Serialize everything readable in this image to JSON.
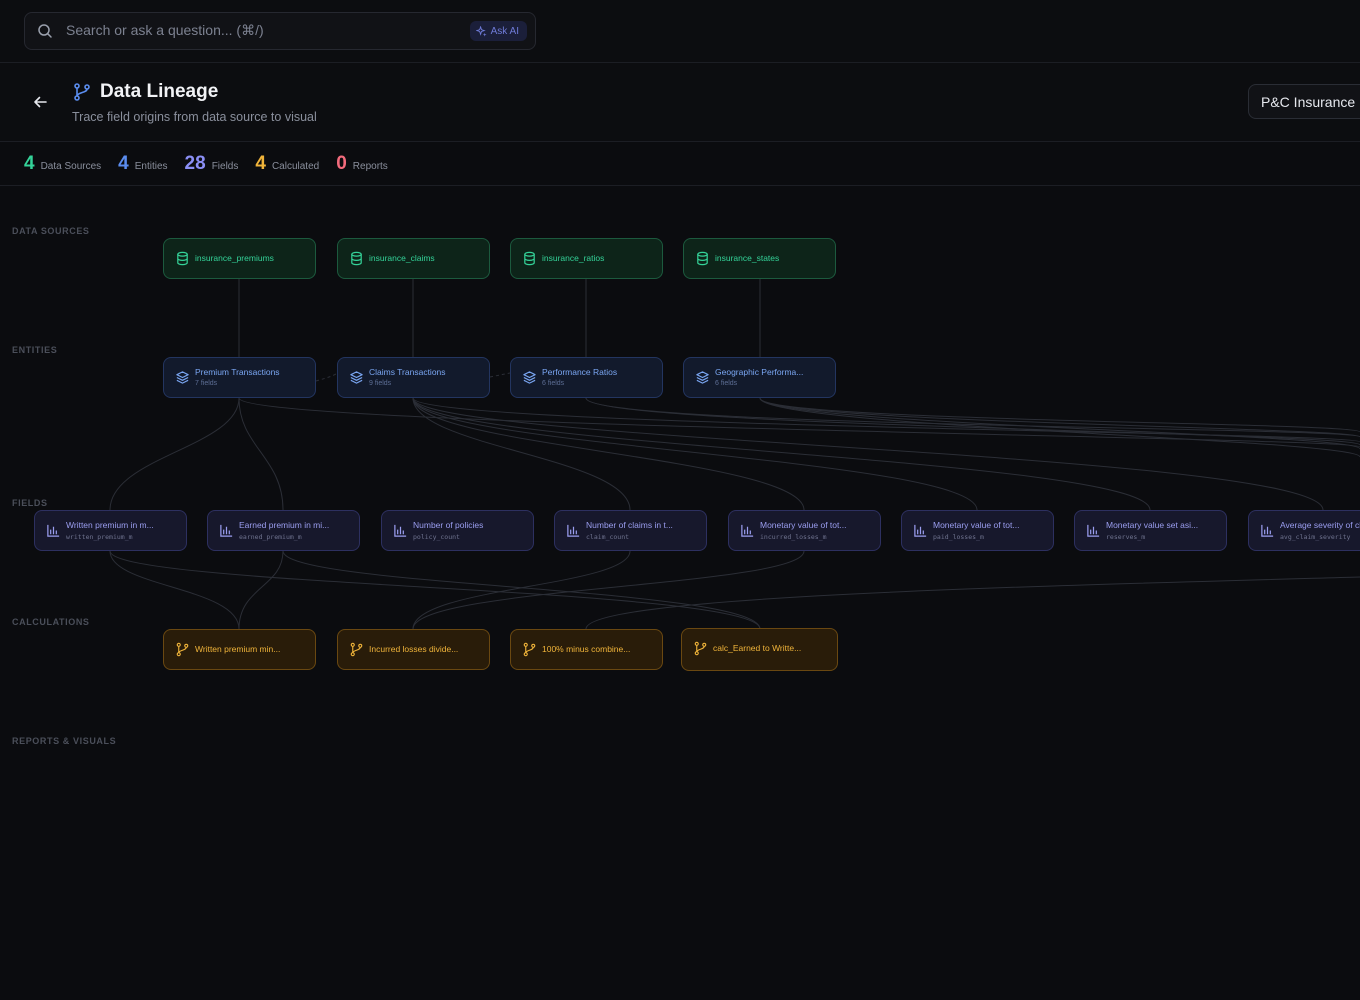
{
  "search": {
    "placeholder": "Search or ask a question... (⌘/)",
    "ask_ai_label": "Ask AI"
  },
  "header": {
    "title": "Data Lineage",
    "subtitle": "Trace field origins from data source to visual",
    "dataset_label": "P&C Insurance D"
  },
  "stats": [
    {
      "value": "4",
      "label": "Data Sources",
      "color": "#34d399"
    },
    {
      "value": "4",
      "label": "Entities",
      "color": "#5b8def"
    },
    {
      "value": "28",
      "label": "Fields",
      "color": "#8b8ff5"
    },
    {
      "value": "4",
      "label": "Calculated",
      "color": "#f0b43a"
    },
    {
      "value": "0",
      "label": "Reports",
      "color": "#f26b7c"
    }
  ],
  "lanes": {
    "data_sources": "DATA SOURCES",
    "entities": "ENTITIES",
    "fields": "FIELDS",
    "calculations": "CALCULATIONS",
    "reports": "REPORTS & VISUALS"
  },
  "data_sources": [
    "insurance_premiums",
    "insurance_claims",
    "insurance_ratios",
    "insurance_states"
  ],
  "entities": [
    {
      "name": "Premium Transactions",
      "fields": "7 fields"
    },
    {
      "name": "Claims Transactions",
      "fields": "9 fields"
    },
    {
      "name": "Performance Ratios",
      "fields": "6 fields"
    },
    {
      "name": "Geographic Performa...",
      "fields": "6 fields"
    }
  ],
  "fields": [
    {
      "name": "Written premium in m...",
      "column": "written_premium_m"
    },
    {
      "name": "Earned premium in mi...",
      "column": "earned_premium_m"
    },
    {
      "name": "Number of policies",
      "column": "policy_count"
    },
    {
      "name": "Number of claims in t...",
      "column": "claim_count"
    },
    {
      "name": "Monetary value of tot...",
      "column": "incurred_losses_m"
    },
    {
      "name": "Monetary value of tot...",
      "column": "paid_losses_m"
    },
    {
      "name": "Monetary value set asi...",
      "column": "reserves_m"
    },
    {
      "name": "Average severity of cl...",
      "column": "avg_claim_severity"
    }
  ],
  "calculations": [
    "Written premium min...",
    "Incurred losses divide...",
    "100% minus combine...",
    "calc_Earned to Writte..."
  ],
  "icons": {
    "search": "search-icon",
    "ask_ai": "sparkle-icon",
    "back": "arrow-left-icon",
    "lineage": "git-branch-icon",
    "data_source": "database-icon",
    "entity": "layers-icon",
    "field": "bar-chart-icon",
    "calculation": "git-branch-icon"
  }
}
